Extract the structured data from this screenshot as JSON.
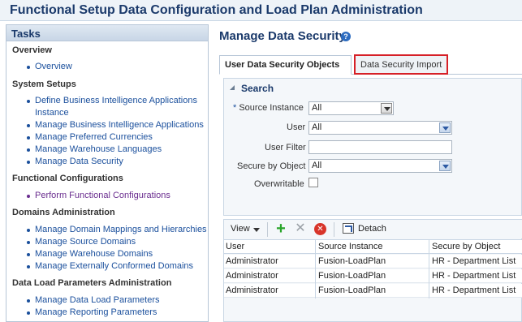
{
  "page_title": "Functional Setup Data Configuration and Load Plan Administration",
  "tasks": {
    "header": "Tasks",
    "sections": [
      {
        "title": "Overview",
        "items": [
          "Overview"
        ]
      },
      {
        "title": "System Setups",
        "items": [
          "Define Business Intelligence Applications",
          "Instance",
          "Manage Business Intelligence Applications",
          "Manage Preferred Currencies",
          "Manage Warehouse Languages",
          "Manage Data Security"
        ]
      },
      {
        "title": "Functional Configurations",
        "items": [
          "Perform Functional Configurations"
        ]
      },
      {
        "title": "Domains Administration",
        "items": [
          "Manage Domain Mappings and Hierarchies",
          "Manage Source Domains",
          "Manage Warehouse Domains",
          "Manage Externally Conformed Domains"
        ]
      },
      {
        "title": "Data Load Parameters Administration",
        "items": [
          "Manage Data Load Parameters",
          "Manage Reporting Parameters"
        ]
      }
    ]
  },
  "main": {
    "title": "Manage Data Security",
    "help_icon": "?",
    "tabs": [
      {
        "label": "User Data Security Objects"
      },
      {
        "label": "Data Security Import"
      }
    ],
    "search": {
      "title": "Search",
      "required_mark": "*",
      "fields": {
        "source_instance": {
          "label": "Source Instance",
          "value": "All"
        },
        "user": {
          "label": "User",
          "value": "All"
        },
        "user_filter": {
          "label": "User Filter",
          "value": ""
        },
        "secure_by_object": {
          "label": "Secure by Object",
          "value": "All"
        },
        "overwritable": {
          "label": "Overwritable"
        }
      }
    },
    "toolbar": {
      "view": "View",
      "detach": "Detach"
    },
    "table": {
      "columns": [
        "User",
        "Source Instance",
        "Secure by Object"
      ],
      "rows": [
        [
          "Administrator",
          "Fusion-LoadPlan",
          "HR - Department List"
        ],
        [
          "Administrator",
          "Fusion-LoadPlan",
          "HR - Department List"
        ],
        [
          "Administrator",
          "Fusion-LoadPlan",
          "HR - Department List"
        ]
      ]
    }
  }
}
